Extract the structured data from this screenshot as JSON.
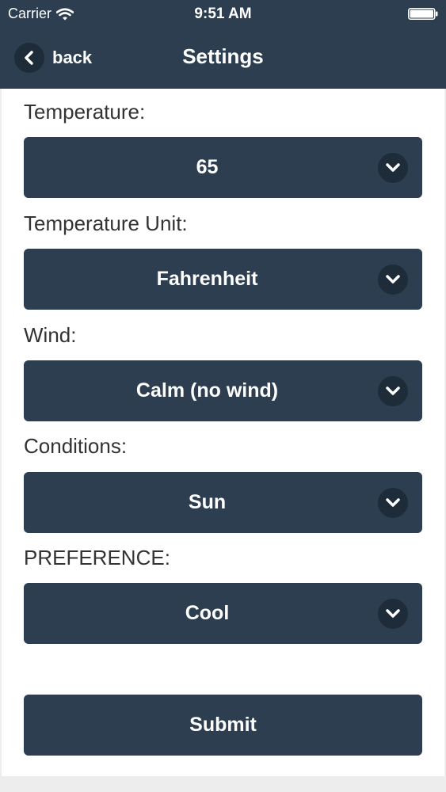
{
  "status_bar": {
    "carrier": "Carrier",
    "time": "9:51 AM",
    "wifi_icon": "wifi-icon",
    "battery_icon": "battery-icon"
  },
  "nav": {
    "back_label": "back",
    "back_icon": "chevron-left-icon",
    "title": "Settings"
  },
  "form": {
    "temperature": {
      "label": "Temperature:",
      "value": "65"
    },
    "temperature_unit": {
      "label": "Temperature Unit:",
      "value": "Fahrenheit"
    },
    "wind": {
      "label": "Wind:",
      "value": "Calm (no wind)"
    },
    "conditions": {
      "label": "Conditions:",
      "value": "Sun"
    },
    "preference": {
      "label": "PREFERENCE:",
      "value": "Cool"
    },
    "dropdown_icon": "chevron-down-icon",
    "submit_label": "Submit"
  },
  "colors": {
    "primary": "#2c3e50",
    "icon_circle": "#1e2b38",
    "text": "#333333",
    "background": "#ffffff"
  }
}
